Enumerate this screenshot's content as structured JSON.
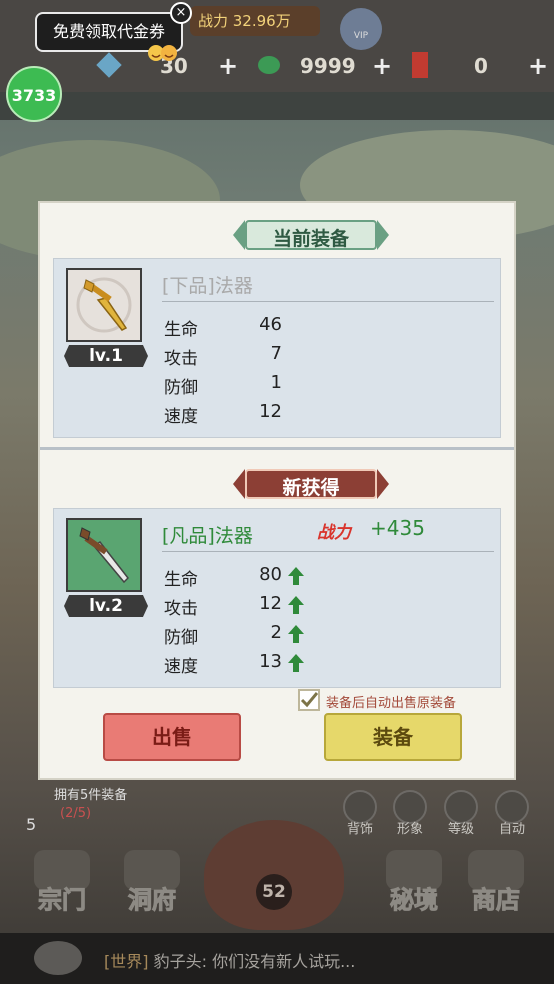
{
  "top": {
    "power_label": "战力 32.96万",
    "vip_label": "VIP",
    "resource_1": "30",
    "resource_2": "9999",
    "resource_3": "0",
    "tooltip": "免费领取代金券",
    "tooltip_close": "×",
    "coin_badge": "3733"
  },
  "modal": {
    "current_banner": "当前装备",
    "current": {
      "level": "lv.1",
      "name": "[下品]法器",
      "stats": [
        {
          "label": "生命",
          "value": "46"
        },
        {
          "label": "攻击",
          "value": "7"
        },
        {
          "label": "防御",
          "value": "1"
        },
        {
          "label": "速度",
          "value": "12"
        }
      ]
    },
    "new_banner": "新获得",
    "new_item": {
      "level": "lv.2",
      "name": "[凡品]法器",
      "power_label": "战力",
      "power_delta": "+435",
      "stats": [
        {
          "label": "生命",
          "value": "80"
        },
        {
          "label": "攻击",
          "value": "12"
        },
        {
          "label": "防御",
          "value": "2"
        },
        {
          "label": "速度",
          "value": "13"
        }
      ]
    },
    "auto_sell_label": "装备后自动出售原装备",
    "auto_sell_checked": true,
    "sell_button": "出售",
    "equip_button": "装备"
  },
  "bottom": {
    "gear_count": "拥有5件装备",
    "gear_progress": "(2/5)",
    "gear_five": "5",
    "round_buttons": [
      "背饰",
      "形象",
      "等级",
      "自动"
    ],
    "nav": [
      "宗门",
      "洞府",
      "秘境",
      "商店"
    ],
    "bag_number": "52",
    "chat_channel": "[世界]",
    "chat_message": "豹子头: 你们没有新人试玩..."
  },
  "colors": {
    "positive": "#2f8a3a",
    "power": "#d9342c",
    "sell": "#e97b75",
    "equip": "#e6d86a"
  }
}
